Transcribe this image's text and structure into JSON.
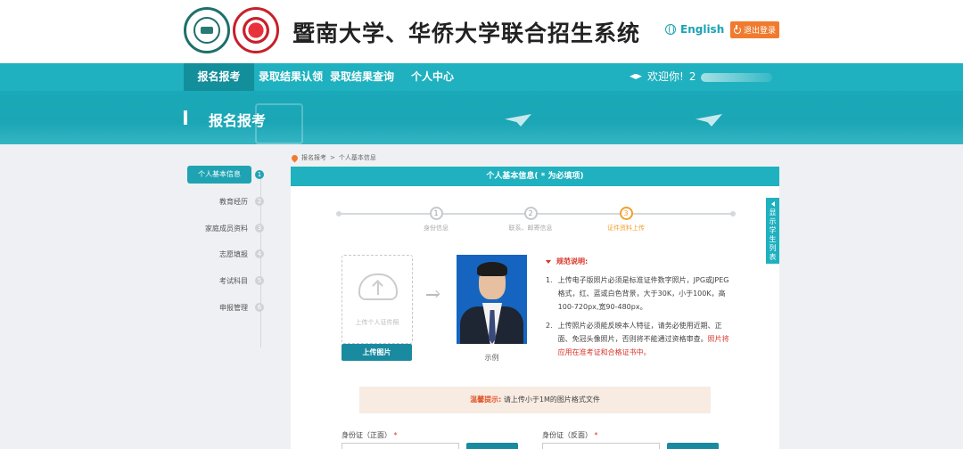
{
  "header": {
    "title": "暨南大学、华侨大学联合招生系统",
    "lang_label": "English",
    "logout_label": "退出登录"
  },
  "nav": {
    "items": [
      "报名报考",
      "录取结果认领",
      "录取结果查询",
      "个人中心"
    ],
    "welcome": "欢迎你!",
    "username": "2"
  },
  "banner": {
    "title": "报名报考"
  },
  "breadcrumb": {
    "root": "报名报考",
    "sep": ">",
    "current": "个人基本信息"
  },
  "sidebar": {
    "items": [
      {
        "label": "个人基本信息",
        "num": "1"
      },
      {
        "label": "教育经历",
        "num": "2"
      },
      {
        "label": "家庭成员资料",
        "num": "3"
      },
      {
        "label": "志愿填报",
        "num": "4"
      },
      {
        "label": "考试科目",
        "num": "5"
      },
      {
        "label": "申报管理",
        "num": "6"
      }
    ]
  },
  "panel": {
    "title": "个人基本信息( * 为必填项)",
    "steps": [
      {
        "num": "1",
        "label": "身份信息"
      },
      {
        "num": "2",
        "label": "联系、邮寄信息"
      },
      {
        "num": "3",
        "label": "证件资料上传"
      }
    ],
    "upload_hint": "上传个人证件照",
    "upload_button": "上传图片",
    "photo_caption": "示例",
    "rules_title": "规范说明:",
    "rules": [
      {
        "num": "1.",
        "text": "上传电子版照片必须是标准证件数字照片，JPG或JPEG格式，红、蓝或白色背景，大于30K，小于100K，高100-720px,宽90-480px。"
      },
      {
        "num": "2.",
        "text": "上传照片必须能反映本人特征，请务必使用近期、正面、免冠头像照片，否则将不能通过资格审查。",
        "red": "照片将应用在准考证和合格证书中。"
      }
    ],
    "tip_label": "温馨提示:",
    "tip_text": "请上传小于1M的图片格式文件",
    "id_front_label": "身份证（正面）",
    "id_back_label": "身份证（反面）",
    "required_mark": "*"
  },
  "float_tab": {
    "chars": [
      "显",
      "示",
      "学",
      "生",
      "列",
      "表"
    ]
  },
  "colors": {
    "primary": "#1fb1bf",
    "active_nav": "#138e9b",
    "accent": "#f07b2e",
    "warning": "#d9352b"
  }
}
